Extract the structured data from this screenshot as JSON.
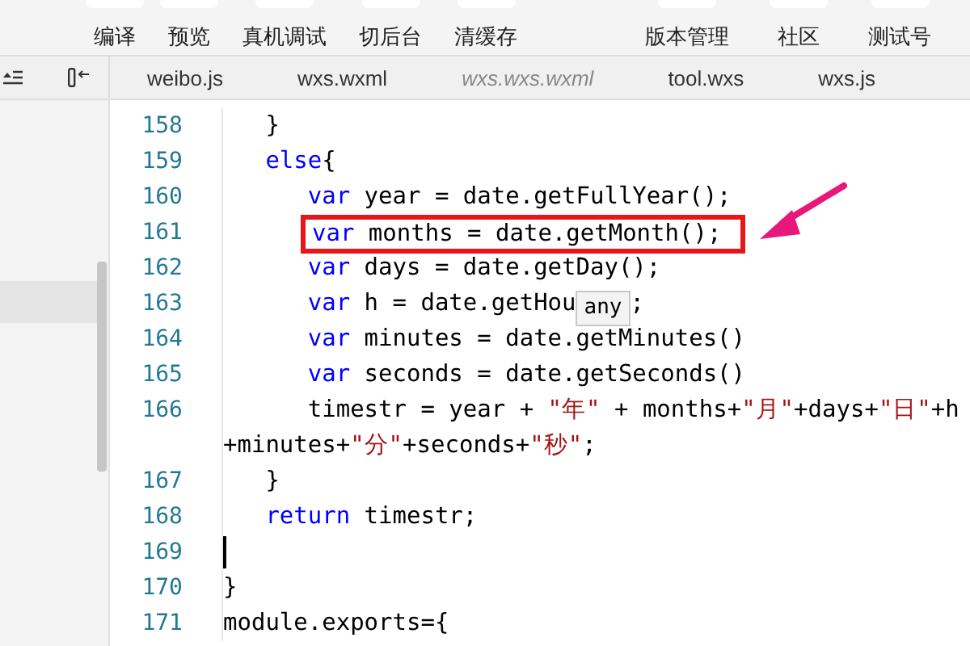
{
  "toolbar": {
    "left": [
      "编译",
      "预览",
      "真机调试",
      "切后台",
      "清缓存"
    ],
    "right": [
      "版本管理",
      "社区",
      "测试号"
    ]
  },
  "tabs": [
    {
      "label": "weibo.js",
      "preview": false
    },
    {
      "label": "wxs.wxml",
      "preview": false
    },
    {
      "label": "wxs.wxs.wxml",
      "preview": true
    },
    {
      "label": "tool.wxs",
      "preview": false
    },
    {
      "label": "wxs.js",
      "preview": false
    }
  ],
  "editor": {
    "lines": [
      {
        "number": "158",
        "tokens": [
          {
            "kind": "text",
            "text": "   }"
          }
        ]
      },
      {
        "number": "159",
        "tokens": [
          {
            "kind": "keyword",
            "text": "   else"
          },
          {
            "kind": "text",
            "text": "{"
          }
        ]
      },
      {
        "number": "160",
        "tokens": [
          {
            "kind": "keyword",
            "text": "      var"
          },
          {
            "kind": "text",
            "text": " year = date.getFullYear();"
          }
        ]
      },
      {
        "number": "161",
        "highlighted": true,
        "tokens": [
          {
            "kind": "keyword",
            "text": "var"
          },
          {
            "kind": "text",
            "text": " months = date.getMonth();"
          }
        ]
      },
      {
        "number": "162",
        "tokens": [
          {
            "kind": "keyword",
            "text": "      var"
          },
          {
            "kind": "text",
            "text": " days = date.getDay();"
          }
        ]
      },
      {
        "number": "163",
        "tokens": [
          {
            "kind": "keyword",
            "text": "      var"
          },
          {
            "kind": "text",
            "text": " h = date.getHou"
          },
          {
            "kind": "tooltip",
            "text": "any"
          },
          {
            "kind": "text",
            "text": ";"
          }
        ]
      },
      {
        "number": "164",
        "tokens": [
          {
            "kind": "keyword",
            "text": "      var"
          },
          {
            "kind": "text",
            "text": " minutes = date.getMinutes()"
          }
        ]
      },
      {
        "number": "165",
        "tokens": [
          {
            "kind": "keyword",
            "text": "      var"
          },
          {
            "kind": "text",
            "text": " seconds = date.getSeconds()"
          }
        ]
      },
      {
        "number": "166",
        "tokens": [
          {
            "kind": "text",
            "text": "      timestr = year + "
          },
          {
            "kind": "string",
            "text": "\"年\""
          },
          {
            "kind": "text",
            "text": " + months+"
          },
          {
            "kind": "string",
            "text": "\"月\""
          },
          {
            "kind": "text",
            "text": "+days+"
          },
          {
            "kind": "string",
            "text": "\"日\""
          },
          {
            "kind": "text",
            "text": "+h"
          }
        ]
      },
      {
        "tokens": [
          {
            "kind": "text",
            "text": "+minutes+"
          },
          {
            "kind": "string",
            "text": "\"分\""
          },
          {
            "kind": "text",
            "text": "+seconds+"
          },
          {
            "kind": "string",
            "text": "\"秒\""
          },
          {
            "kind": "text",
            "text": ";"
          }
        ]
      },
      {
        "number": "167",
        "tokens": [
          {
            "kind": "text",
            "text": "   }"
          }
        ]
      },
      {
        "number": "168",
        "tokens": [
          {
            "kind": "keyword",
            "text": "   return"
          },
          {
            "kind": "text",
            "text": " timestr;"
          }
        ]
      },
      {
        "number": "169",
        "cursor": true
      },
      {
        "number": "170",
        "tokens": [
          {
            "kind": "text",
            "text": "}"
          }
        ]
      },
      {
        "number": "171",
        "tokens": [
          {
            "kind": "text",
            "text": "module.exports={"
          }
        ]
      }
    ]
  }
}
